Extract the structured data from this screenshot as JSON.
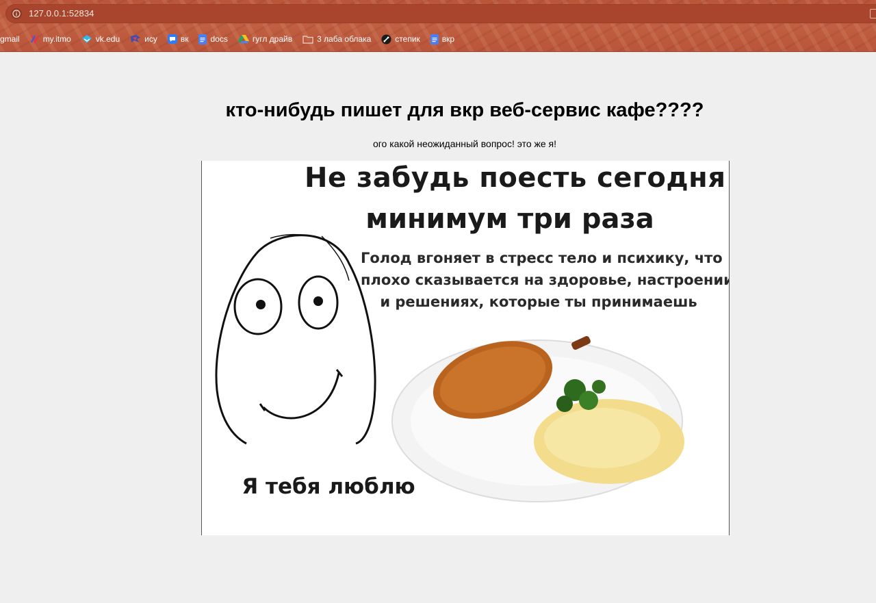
{
  "browser": {
    "url": "127.0.0.1:52834",
    "bookmarks": [
      {
        "label": "gmail",
        "icon": "none"
      },
      {
        "label": "my.itmo",
        "icon": "itmo-icon"
      },
      {
        "label": "vk.edu",
        "icon": "vk-edu-icon"
      },
      {
        "label": "ису",
        "icon": "isu-icon"
      },
      {
        "label": "вк",
        "icon": "chat-icon"
      },
      {
        "label": "docs",
        "icon": "docs-icon"
      },
      {
        "label": "гугл драйв",
        "icon": "drive-icon"
      },
      {
        "label": "3 лаба облака",
        "icon": "folder-icon"
      },
      {
        "label": "степик",
        "icon": "stepik-icon"
      },
      {
        "label": "вкр",
        "icon": "docs-icon"
      }
    ]
  },
  "page": {
    "title": "кто-нибудь пишет для вкр веб-сервис кафе????",
    "subtitle": "ого какой неожиданный вопрос! это же я!"
  },
  "meme": {
    "headline_line1": "Не забудь поесть сегодня",
    "headline_line2": "минимум три раза",
    "body_line1": "Голод вгоняет в стресс тело и психику, что",
    "body_line2": "плохо сказывается на здоровье, настроении",
    "body_line3": "и решениях, которые ты принимаешь",
    "caption": "Я тебя люблю"
  },
  "colors": {
    "chrome_bg": "#b9553a",
    "page_bg": "#efefef"
  }
}
